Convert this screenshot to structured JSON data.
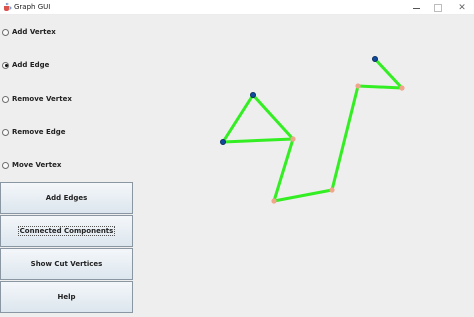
{
  "window": {
    "title": "Graph GUI",
    "icon": "java-cup-icon"
  },
  "modes": [
    {
      "label": "Add Vertex",
      "selected": false
    },
    {
      "label": "Add Edge",
      "selected": true
    },
    {
      "label": "Remove Vertex",
      "selected": false
    },
    {
      "label": "Remove Edge",
      "selected": false
    },
    {
      "label": "Move Vertex",
      "selected": false
    }
  ],
  "buttons": [
    {
      "label": "Add Edges",
      "focused": false
    },
    {
      "label": "Connected Components",
      "focused": true
    },
    {
      "label": "Show Cut Vertices",
      "focused": false
    },
    {
      "label": "Help",
      "focused": false
    }
  ],
  "graph": {
    "edge_color": "#33ee22",
    "vertices": [
      {
        "id": "v1",
        "type": "dark",
        "color": "#0d4a9e"
      },
      {
        "id": "v2",
        "type": "dark",
        "color": "#0d4a9e"
      },
      {
        "id": "v3",
        "type": "light",
        "color": "#f0a68a"
      },
      {
        "id": "v4",
        "type": "light",
        "color": "#f0a68a"
      },
      {
        "id": "v5",
        "type": "light",
        "color": "#f0a68a"
      },
      {
        "id": "v6",
        "type": "light",
        "color": "#f0a68a"
      },
      {
        "id": "v7",
        "type": "light",
        "color": "#f0a68a"
      },
      {
        "id": "v8",
        "type": "dark",
        "color": "#0d4a9e"
      }
    ],
    "edges": [
      [
        "v1",
        "v2"
      ],
      [
        "v1",
        "v3"
      ],
      [
        "v2",
        "v3"
      ],
      [
        "v3",
        "v4"
      ],
      [
        "v4",
        "v5"
      ],
      [
        "v5",
        "v6"
      ],
      [
        "v6",
        "v7"
      ],
      [
        "v7",
        "v8"
      ]
    ]
  }
}
